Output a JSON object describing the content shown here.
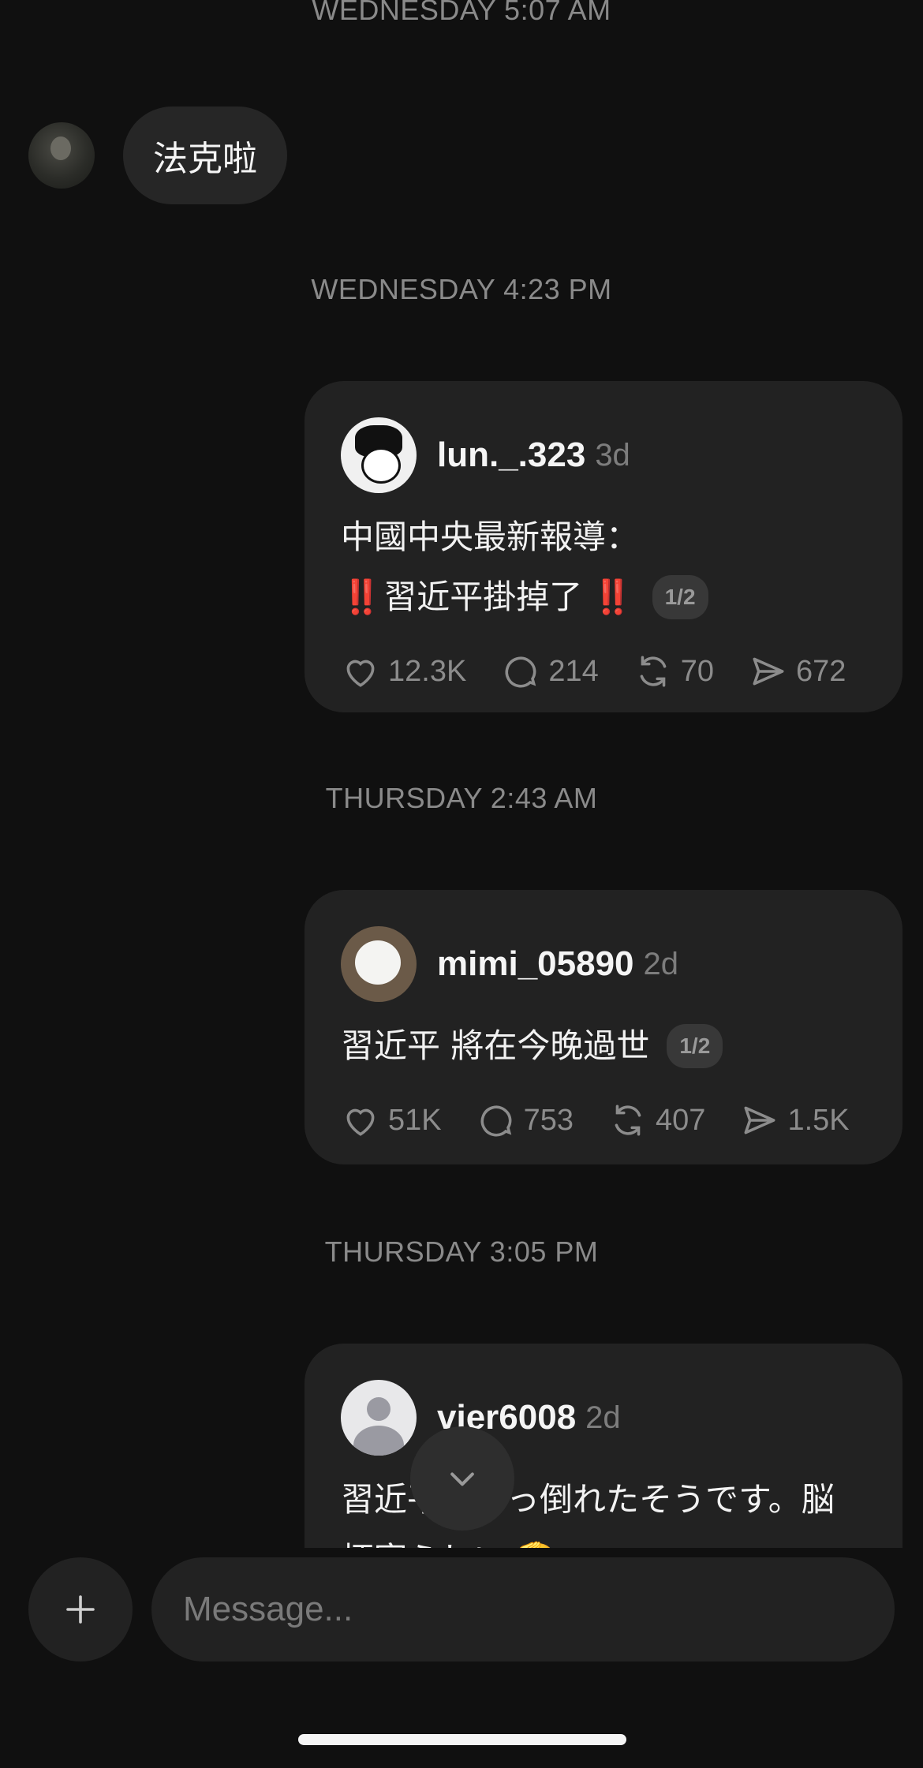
{
  "timestamps": {
    "t0": "WEDNESDAY 5:07 AM",
    "t1": "WEDNESDAY 4:23 PM",
    "t2": "THURSDAY 2:43 AM",
    "t3": "THURSDAY 3:05 PM"
  },
  "incoming": {
    "text": "法克啦"
  },
  "posts": [
    {
      "username": "lun._.323",
      "age": "3d",
      "lines": [
        "中國中央最新報導：",
        "習近平掛掉了"
      ],
      "pager": "1/2",
      "likes": "12.3K",
      "comments": "214",
      "reposts": "70",
      "shares": "672"
    },
    {
      "username": "mimi_05890",
      "age": "2d",
      "lines": [
        "習近平 將在今晚過世"
      ],
      "pager": "1/2",
      "likes": "51K",
      "comments": "753",
      "reposts": "407",
      "shares": "1.5K"
    },
    {
      "username": "vier6008",
      "age": "2d",
      "lines": [
        "習近平がぶっ倒れたそうです。脳",
        "梗塞らしい 🫡"
      ]
    }
  ],
  "bang_glyph": "‼️",
  "composer": {
    "placeholder": "Message..."
  },
  "colors": {
    "background": "#101010",
    "card": "#222222",
    "alert_red": "#e53935"
  }
}
